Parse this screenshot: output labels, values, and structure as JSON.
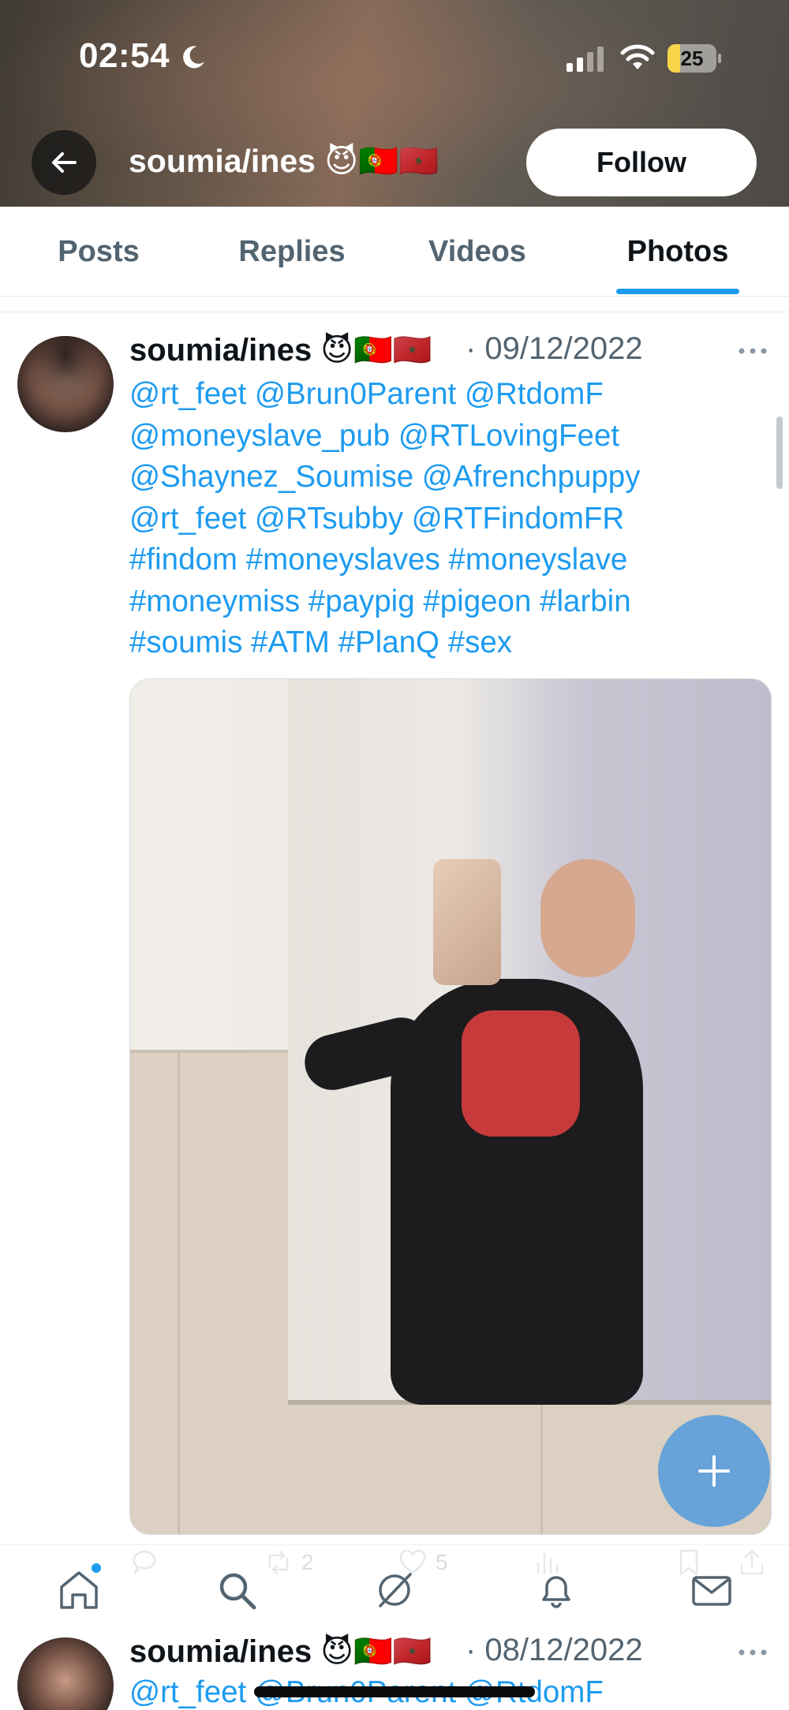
{
  "status_bar": {
    "time": "02:54",
    "battery_level": "25",
    "battery_fraction": 0.25,
    "icons": [
      "moon-icon",
      "signal-icon",
      "wifi-icon",
      "battery-icon"
    ]
  },
  "header": {
    "back_icon": "back-arrow-icon",
    "profile_name": "soumia/ines 😈🇵🇹🇲🇦",
    "follow_label": "Follow"
  },
  "tabs": [
    {
      "label": "Posts",
      "active": false
    },
    {
      "label": "Replies",
      "active": false
    },
    {
      "label": "Videos",
      "active": false
    },
    {
      "label": "Photos",
      "active": true
    }
  ],
  "post": {
    "author": "soumia/ines 😈🇵🇹🇲🇦",
    "date": "· 09/12/2022",
    "text_lines": [
      "@rt_feet   @Brun0Parent @RtdomF",
      "@moneyslave_pub @RTLovingFeet",
      "@Shaynez_Soumise @Afrenchpuppy",
      "@rt_feet @RTsubby @RTFindomFR",
      "#findom #moneyslaves #moneyslave",
      "#moneymiss #paypig #pigeon #larbin",
      "#soumis #ATM #PlanQ #sex"
    ],
    "actions": {
      "reply_count": "",
      "repost_count": "2",
      "like_count": "5",
      "views_count": ""
    }
  },
  "fab": {
    "icon": "plus-icon"
  },
  "bottom_nav": {
    "items": [
      "home-icon",
      "search-icon",
      "grok-icon",
      "notifications-icon",
      "messages-icon"
    ],
    "accent": "#1d9bf0"
  },
  "next_post": {
    "author": "soumia/ines 😈🇵🇹🇲🇦",
    "date": "· 08/12/2022",
    "text_line": "@rt_feet   @Brun0Parent @RtdomF"
  },
  "colors": {
    "link": "#1d9bf0",
    "secondary_text": "#536471",
    "primary_text": "#0f1419"
  }
}
